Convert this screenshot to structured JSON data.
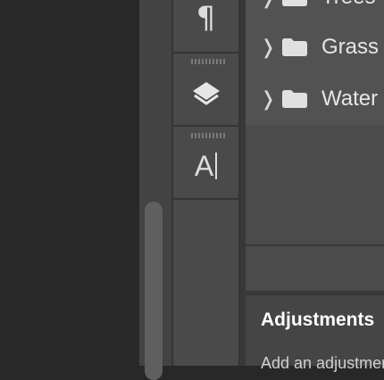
{
  "layers_panel": {
    "groups": [
      {
        "name": "Trees",
        "icon": "folder-icon",
        "expand_icon": "chevron-right-icon"
      },
      {
        "name": "Grass",
        "icon": "folder-icon",
        "expand_icon": "chevron-right-icon"
      },
      {
        "name": "Water",
        "icon": "folder-icon",
        "expand_icon": "chevron-right-icon"
      }
    ]
  },
  "icon_dock": {
    "paragraph_symbol": "¶",
    "character_symbol": "A"
  },
  "adjustments_panel": {
    "title": "Adjustments",
    "description": "Add an adjustment"
  },
  "colors": {
    "canvas": "#282828",
    "panel": "#4b4b4b",
    "text": "#e6e6e6"
  }
}
